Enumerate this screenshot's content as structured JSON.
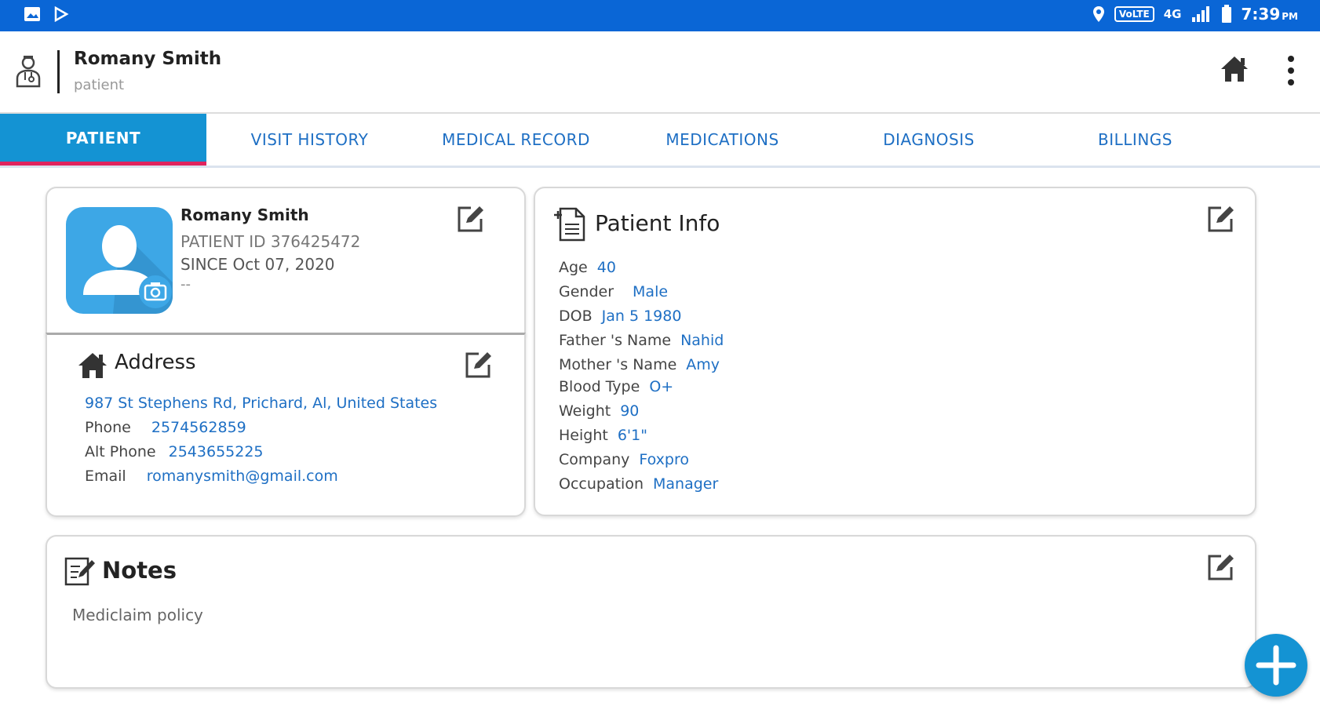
{
  "status_bar": {
    "network_badge": "VoLTE",
    "network_type": "4G",
    "time": "7:39",
    "time_suffix": "PM"
  },
  "app_bar": {
    "title": "Romany Smith",
    "subtitle": "patient"
  },
  "tabs": [
    {
      "label": "PATIENT",
      "active": true
    },
    {
      "label": "VISIT HISTORY",
      "active": false
    },
    {
      "label": "MEDICAL RECORD",
      "active": false
    },
    {
      "label": "MEDICATIONS",
      "active": false
    },
    {
      "label": "DIAGNOSIS",
      "active": false
    },
    {
      "label": "BILLINGS",
      "active": false
    }
  ],
  "profile": {
    "name": "Romany Smith",
    "patient_id": "PATIENT ID 376425472",
    "since": "SINCE Oct 07, 2020",
    "extra": "--"
  },
  "address": {
    "title": "Address",
    "street": "987 St Stephens Rd, Prichard, Al, United States",
    "phone_label": "Phone",
    "phone": "2574562859",
    "alt_phone_label": "Alt Phone",
    "alt_phone": "2543655225",
    "email_label": "Email",
    "email": "romanysmith@gmail.com"
  },
  "patient_info": {
    "title": "Patient Info",
    "fields": [
      {
        "label": "Age",
        "value": "40"
      },
      {
        "label": "Gender",
        "value": "Male"
      },
      {
        "label": "DOB",
        "value": "Jan 5 1980"
      },
      {
        "label": "Father 's Name",
        "value": "Nahid"
      },
      {
        "label": "Mother 's Name",
        "value": "Amy"
      },
      {
        "label": "Blood Type",
        "value": "O+"
      },
      {
        "label": "Weight",
        "value": "90"
      },
      {
        "label": "Height",
        "value": "6'1\""
      },
      {
        "label": "Company",
        "value": "Foxpro"
      },
      {
        "label": "Occupation",
        "value": "Manager"
      }
    ]
  },
  "notes": {
    "title": "Notes",
    "text": "Mediclaim policy"
  },
  "colors": {
    "status_bar": "#0a66d6",
    "tab_active": "#1493d3",
    "tab_indicator": "#e0245e",
    "link": "#1e6fc4",
    "fab": "#1493d3"
  },
  "icons": {
    "app_bar_left": "doctor-icon",
    "home": "home-icon",
    "more": "more-vert-icon",
    "edit": "edit-icon",
    "camera": "camera-icon",
    "fab": "plus-icon"
  }
}
